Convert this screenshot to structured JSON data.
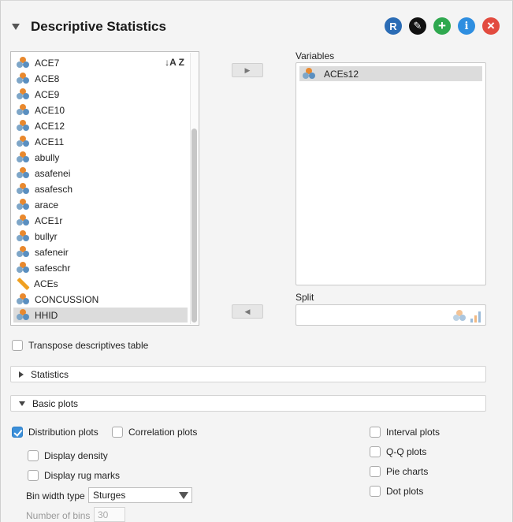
{
  "header": {
    "title": "Descriptive Statistics",
    "icons": [
      {
        "name": "r-icon",
        "glyph": "R",
        "color": "#2b6cb5"
      },
      {
        "name": "edit-icon",
        "glyph": "✎",
        "color": "#111111"
      },
      {
        "name": "add-icon",
        "glyph": "+",
        "color": "#2fa84f"
      },
      {
        "name": "info-icon",
        "glyph": "i",
        "color": "#2e8ee0"
      },
      {
        "name": "close-icon",
        "glyph": "×",
        "color": "#e24b3f"
      }
    ]
  },
  "variables_list": {
    "sort_glyph": "↓A Z",
    "items": [
      {
        "label": "ACE7",
        "type": "nominal"
      },
      {
        "label": "ACE8",
        "type": "nominal"
      },
      {
        "label": "ACE9",
        "type": "nominal"
      },
      {
        "label": "ACE10",
        "type": "nominal"
      },
      {
        "label": "ACE12",
        "type": "nominal"
      },
      {
        "label": "ACE11",
        "type": "nominal"
      },
      {
        "label": "abully",
        "type": "nominal"
      },
      {
        "label": "asafenei",
        "type": "nominal"
      },
      {
        "label": "asafesch",
        "type": "nominal"
      },
      {
        "label": "arace",
        "type": "nominal"
      },
      {
        "label": "ACE1r",
        "type": "nominal"
      },
      {
        "label": "bullyr",
        "type": "nominal"
      },
      {
        "label": "safeneir",
        "type": "nominal"
      },
      {
        "label": "safeschr",
        "type": "nominal"
      },
      {
        "label": "ACEs",
        "type": "scale"
      },
      {
        "label": "CONCUSSION",
        "type": "nominal"
      },
      {
        "label": "HHID",
        "type": "nominal",
        "selected": true
      }
    ]
  },
  "buttons": {
    "move_right_glyph": "▶",
    "move_left_glyph": "◀"
  },
  "variables_box": {
    "label": "Variables",
    "items": [
      {
        "label": "ACEs12"
      }
    ]
  },
  "split_box": {
    "label": "Split"
  },
  "options": {
    "transpose_label": "Transpose descriptives table",
    "transpose_checked": false
  },
  "sections": {
    "statistics_label": "Statistics",
    "basic_plots_label": "Basic plots"
  },
  "basic_plots": {
    "distribution_plots": {
      "label": "Distribution plots",
      "checked": true
    },
    "correlation_plots": {
      "label": "Correlation plots",
      "checked": false
    },
    "display_density": {
      "label": "Display density",
      "checked": false
    },
    "display_rug_marks": {
      "label": "Display rug marks",
      "checked": false
    },
    "bin_width_type_label": "Bin width type",
    "bin_width_type_value": "Sturges",
    "number_of_bins_label": "Number of bins",
    "number_of_bins_value": "30",
    "interval_plots": {
      "label": "Interval plots",
      "checked": false
    },
    "qq_plots": {
      "label": "Q-Q plots",
      "checked": false
    },
    "pie_charts": {
      "label": "Pie charts",
      "checked": false
    },
    "dot_plots": {
      "label": "Dot plots",
      "checked": false
    }
  }
}
